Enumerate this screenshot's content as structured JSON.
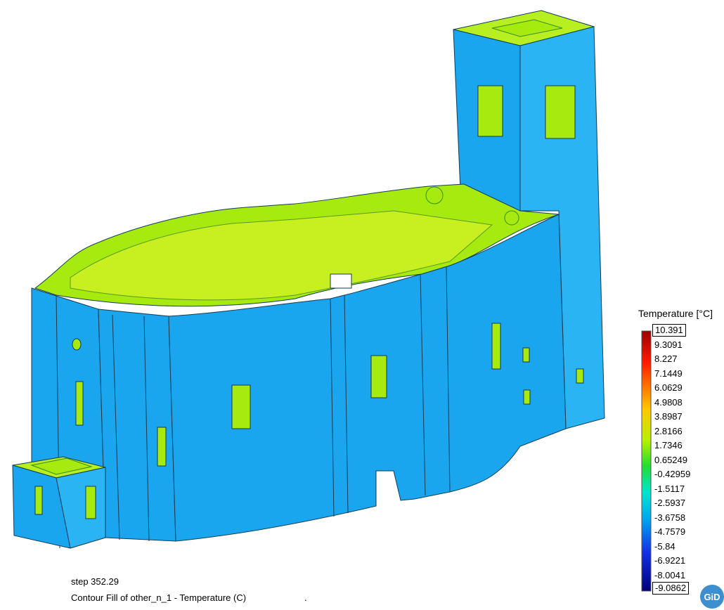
{
  "legend": {
    "title": "Temperature [°C]",
    "ticks": [
      "10.391",
      "9.3091",
      "8.227",
      "7.1449",
      "6.0629",
      "4.9808",
      "3.8987",
      "2.8166",
      "1.7346",
      "0.65249",
      "-0.42959",
      "-1.5117",
      "-2.5937",
      "-3.6758",
      "-4.7579",
      "-5.84",
      "-6.9221",
      "-8.0041",
      "-9.0862"
    ]
  },
  "footer": {
    "step": "step 352.29",
    "contour": "Contour Fill of other_n_1 - Temperature (C)",
    "trailing_mark": "."
  },
  "logo_text": "GiD",
  "colors": {
    "wall_blue": "#1aa6ee",
    "wall_blue_light": "#2ab4f4",
    "interior_green": "#a6ea10",
    "green_bright": "#5ee020",
    "edge": "#123b55"
  }
}
